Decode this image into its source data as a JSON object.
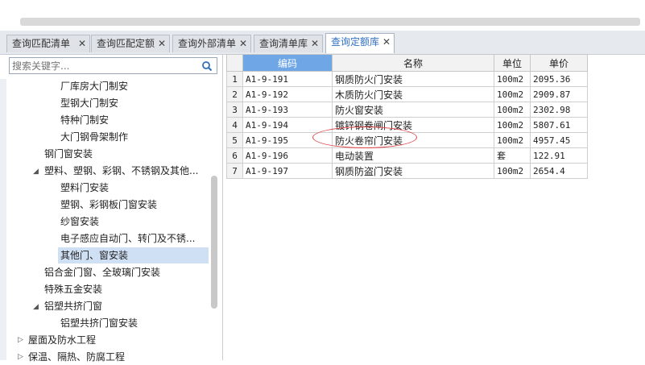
{
  "tabs": [
    {
      "label": "查询匹配清单",
      "close": "✕"
    },
    {
      "label": "查询匹配定额",
      "close": "✕"
    },
    {
      "label": "查询外部清单",
      "close": "✕"
    },
    {
      "label": "查询清单库",
      "close": "✕"
    },
    {
      "label": "查询定额库",
      "close": "✕",
      "active": true
    }
  ],
  "search": {
    "placeholder": "搜索关键字..."
  },
  "tree": {
    "items": [
      {
        "label": "厂库房大门制安"
      },
      {
        "label": "型钢大门制安"
      },
      {
        "label": "特种门制安"
      },
      {
        "label": "大门钢骨架制作"
      },
      {
        "label": "钢门窗安装"
      },
      {
        "label": "塑料、塑钢、彩钢、不锈钢及其他...",
        "expanded": true
      },
      {
        "label": "塑料门安装"
      },
      {
        "label": "塑钢、彩钢板门窗安装"
      },
      {
        "label": "纱窗安装"
      },
      {
        "label": "电子感应自动门、转门及不锈..."
      },
      {
        "label": "其他门、窗安装",
        "selected": true
      },
      {
        "label": "铝合金门窗、全玻璃门安装"
      },
      {
        "label": "特殊五金安装"
      },
      {
        "label": "铝塑共挤门窗",
        "expanded": true
      },
      {
        "label": "铝塑共挤门窗安装"
      },
      {
        "label": "屋面及防水工程",
        "expanded": false
      },
      {
        "label": "保温、隔热、防腐工程",
        "expanded": false
      }
    ]
  },
  "grid": {
    "columns": [
      "编码",
      "名称",
      "单位",
      "单价"
    ],
    "sorted_column": "编码",
    "rows": [
      {
        "n": "1",
        "code": "A1-9-191",
        "name": "钢质防火门安装",
        "unit": "100m2",
        "price": "2095.36"
      },
      {
        "n": "2",
        "code": "A1-9-192",
        "name": "木质防火门安装",
        "unit": "100m2",
        "price": "2909.87"
      },
      {
        "n": "3",
        "code": "A1-9-193",
        "name": "防火窗安装",
        "unit": "100m2",
        "price": "2302.98"
      },
      {
        "n": "4",
        "code": "A1-9-194",
        "name": "镀锌钢卷闸门安装",
        "unit": "100m2",
        "price": "5807.61"
      },
      {
        "n": "5",
        "code": "A1-9-195",
        "name": "防火卷帘门安装",
        "unit": "100m2",
        "price": "4957.45"
      },
      {
        "n": "6",
        "code": "A1-9-196",
        "name": "电动装置",
        "unit": "套",
        "price": "122.91"
      },
      {
        "n": "7",
        "code": "A1-9-197",
        "name": "钢质防盗门安装",
        "unit": "100m2",
        "price": "2654.4"
      }
    ]
  },
  "annotation": {
    "highlight_row": "5",
    "color": "#e0494b"
  },
  "colors": {
    "accent": "#2f6fc0",
    "header_sorted": "#6ea6e6",
    "selected_row": "#cfe0f5"
  }
}
